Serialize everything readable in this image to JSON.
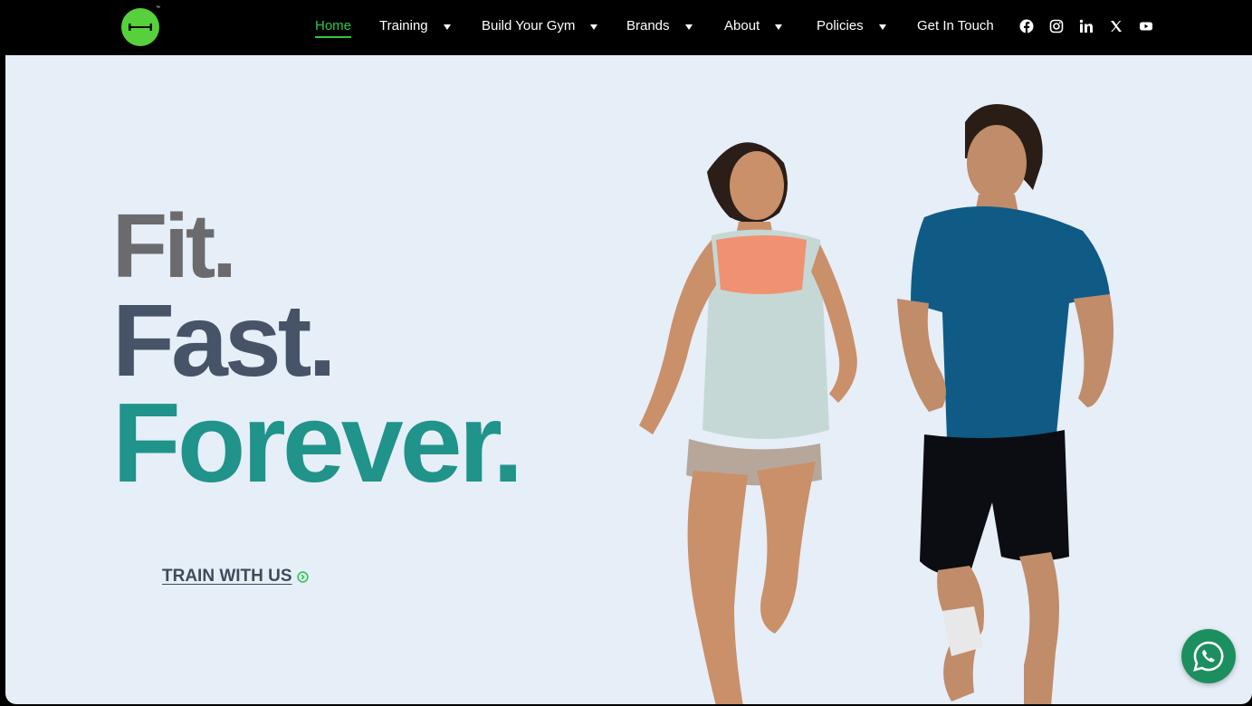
{
  "nav": {
    "items": [
      {
        "label": "Home",
        "active": true,
        "dropdown": false
      },
      {
        "label": "Training",
        "active": false,
        "dropdown": true
      },
      {
        "label": "Build Your Gym",
        "active": false,
        "dropdown": true
      },
      {
        "label": "Brands",
        "active": false,
        "dropdown": true
      },
      {
        "label": "About",
        "active": false,
        "dropdown": true
      },
      {
        "label": "Policies",
        "active": false,
        "dropdown": true
      },
      {
        "label": "Get In Touch",
        "active": false,
        "dropdown": false
      }
    ],
    "logo_mark": "™",
    "social": [
      "facebook-icon",
      "instagram-icon",
      "linkedin-icon",
      "x-icon",
      "youtube-icon"
    ]
  },
  "hero": {
    "line1": "Fit.",
    "line2": "Fast.",
    "line3": "Forever.",
    "cta_label": "TRAIN WITH US",
    "image": "woman-and-man-running-photo"
  },
  "floating": {
    "whatsapp": "whatsapp-icon"
  },
  "colors": {
    "accent_green": "#2cc84a",
    "logo_green": "#56d13b",
    "line1": "#6b6b6e",
    "line2": "#475467",
    "line3": "#20938a",
    "whatsapp": "#1c8f5e",
    "background": "#e6eef8"
  }
}
